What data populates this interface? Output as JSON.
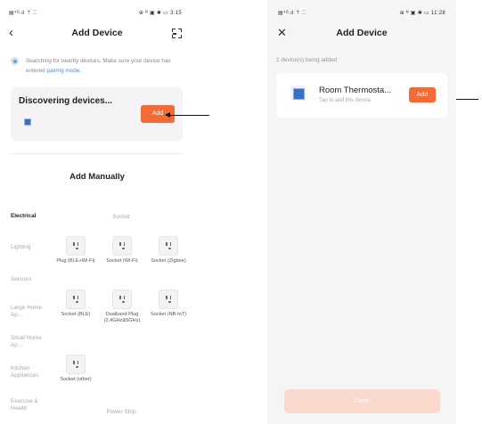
{
  "left_screen": {
    "status_bar": {
      "left": "▤⁴ᴳ.ıl ⇡ ⁚⁚",
      "right": "⊕ ᴺ ▣ ✱ ▭ 3:15"
    },
    "nav": {
      "back_glyph": "‹",
      "title": "Add Device"
    },
    "search_hint": {
      "text": "Searching for nearby devices. Make sure your device has entered ",
      "link": "pairing mode."
    },
    "discover": {
      "title": "Discovering devices...",
      "add_label": "Add"
    },
    "add_manually_title": "Add Manually",
    "categories": [
      "Electrical",
      "Lighting",
      "Sensors",
      "Large Home Ap...",
      "Small Home Ap...",
      "Kitchen Appliances",
      "Exercise & Health"
    ],
    "sections": {
      "socket": "Socket",
      "power_strip": "Power Strip"
    },
    "devices": [
      {
        "label": "Plug (BLE+Wi-Fi)"
      },
      {
        "label": "Socket (Wi-Fi)"
      },
      {
        "label": "Socket (Zigbee)"
      },
      {
        "label": "Socket (BLE)"
      },
      {
        "label": "Dualband Plug (2.4GHz&5GHz)"
      },
      {
        "label": "Socket (NB-IoT)"
      },
      {
        "label": "Socket (other)"
      }
    ]
  },
  "right_screen": {
    "status_bar": {
      "left": "▤⁴ᴳ.ıl ⇡ ⁚⁚",
      "right": "⊕ ᴺ ▣ ✱ ▭ 11:28"
    },
    "nav": {
      "close_glyph": "✕",
      "title": "Add Device"
    },
    "added_label": "1 device(s) being added",
    "device": {
      "name": "Room Thermosta...",
      "sub": "Tap to add this device",
      "add_label": "Add"
    },
    "done_label": "Done"
  },
  "colors": {
    "accent": "#f26a36",
    "accent_disabled": "#fbd9cc",
    "link": "#4a90e2",
    "device_blue": "#3a70c2"
  }
}
